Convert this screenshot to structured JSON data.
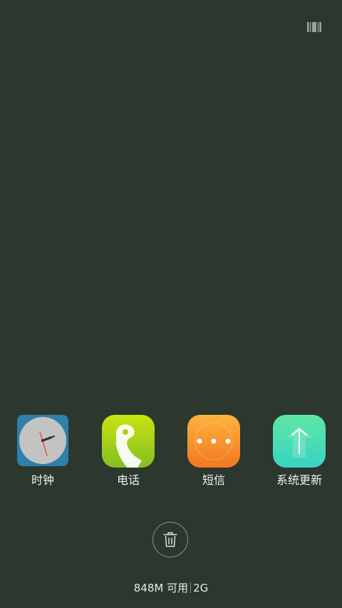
{
  "header": {
    "toggle_icon": "barcode-grid-icon"
  },
  "recent_apps": [
    {
      "label": "时钟",
      "icon": "clock-icon",
      "color": "#2f80aa"
    },
    {
      "label": "电话",
      "icon": "phone-icon",
      "color": "#a8d41a"
    },
    {
      "label": "短信",
      "icon": "message-icon",
      "color": "#f59a2c"
    },
    {
      "label": "系统更新",
      "icon": "system-update-icon",
      "color": "#48dbb6"
    }
  ],
  "clear_button": {
    "icon": "trash-icon"
  },
  "memory": {
    "available": "848M 可用",
    "total": "2G"
  },
  "colors": {
    "background": "#2c372e",
    "text": "#f2f2f2"
  }
}
